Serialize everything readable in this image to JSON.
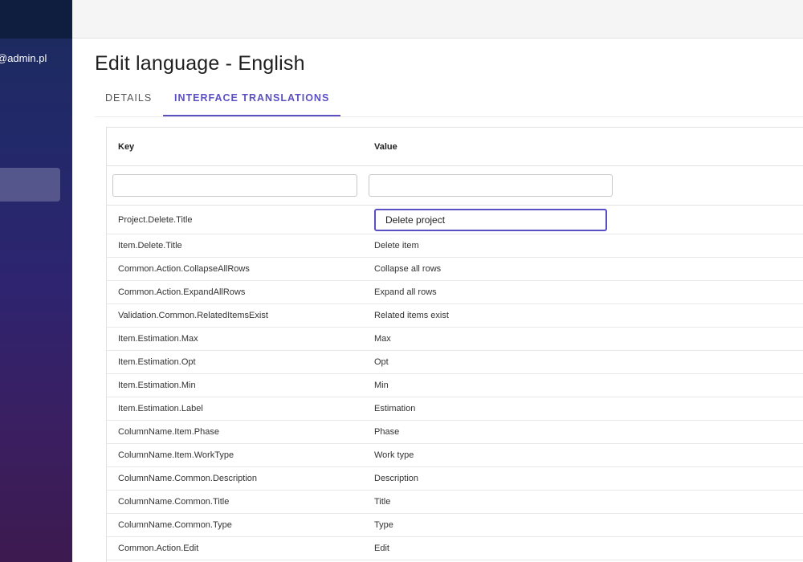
{
  "sidebar": {
    "user_email": "@admin.pl"
  },
  "page": {
    "title": "Edit language - English"
  },
  "tabs": [
    {
      "label": "DETAILS",
      "active": false
    },
    {
      "label": "INTERFACE TRANSLATIONS",
      "active": true
    }
  ],
  "table": {
    "columns": {
      "key": "Key",
      "value": "Value"
    },
    "filters": {
      "key": "",
      "value": ""
    },
    "editing_row": {
      "key": "Project.Delete.Title",
      "value": "Delete project"
    },
    "rows": [
      {
        "key": "Item.Delete.Title",
        "value": "Delete item"
      },
      {
        "key": "Common.Action.CollapseAllRows",
        "value": "Collapse all rows"
      },
      {
        "key": "Common.Action.ExpandAllRows",
        "value": "Expand all rows"
      },
      {
        "key": "Validation.Common.RelatedItemsExist",
        "value": "Related items exist"
      },
      {
        "key": "Item.Estimation.Max",
        "value": "Max"
      },
      {
        "key": "Item.Estimation.Opt",
        "value": "Opt"
      },
      {
        "key": "Item.Estimation.Min",
        "value": "Min"
      },
      {
        "key": "Item.Estimation.Label",
        "value": "Estimation"
      },
      {
        "key": "ColumnName.Item.Phase",
        "value": "Phase"
      },
      {
        "key": "ColumnName.Item.WorkType",
        "value": "Work type"
      },
      {
        "key": "ColumnName.Common.Description",
        "value": "Description"
      },
      {
        "key": "ColumnName.Common.Title",
        "value": "Title"
      },
      {
        "key": "ColumnName.Common.Type",
        "value": "Type"
      },
      {
        "key": "Common.Action.Edit",
        "value": "Edit"
      }
    ]
  },
  "colors": {
    "accent": "#5b4fc4",
    "sidebar_top": "#1b2a5c",
    "sidebar_bottom": "#3d1a4f"
  }
}
